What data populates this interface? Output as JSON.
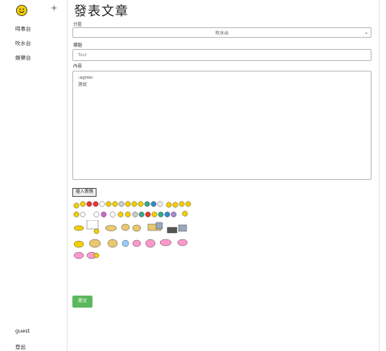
{
  "sidebar": {
    "logo_icon": "smiley-face-icon",
    "add_label": "+",
    "items": [
      {
        "label": "時事台"
      },
      {
        "label": "吹水台"
      },
      {
        "label": "娛樂台"
      }
    ],
    "user": "guest",
    "logout_label": "登出"
  },
  "main": {
    "title": "發表文章",
    "category_label": "分區",
    "category_selected": "吹水台",
    "subject_label": "標題",
    "subject_value": "Test",
    "content_label": "內容",
    "content_lines": [
      ":agree:",
      "測試"
    ],
    "emoji_button_label": "插入表情",
    "submit_label": "提交"
  },
  "colors": {
    "accent_green": "#5cb85c",
    "border": "#bbbbbb",
    "smiley_yellow": "#f5d000"
  }
}
